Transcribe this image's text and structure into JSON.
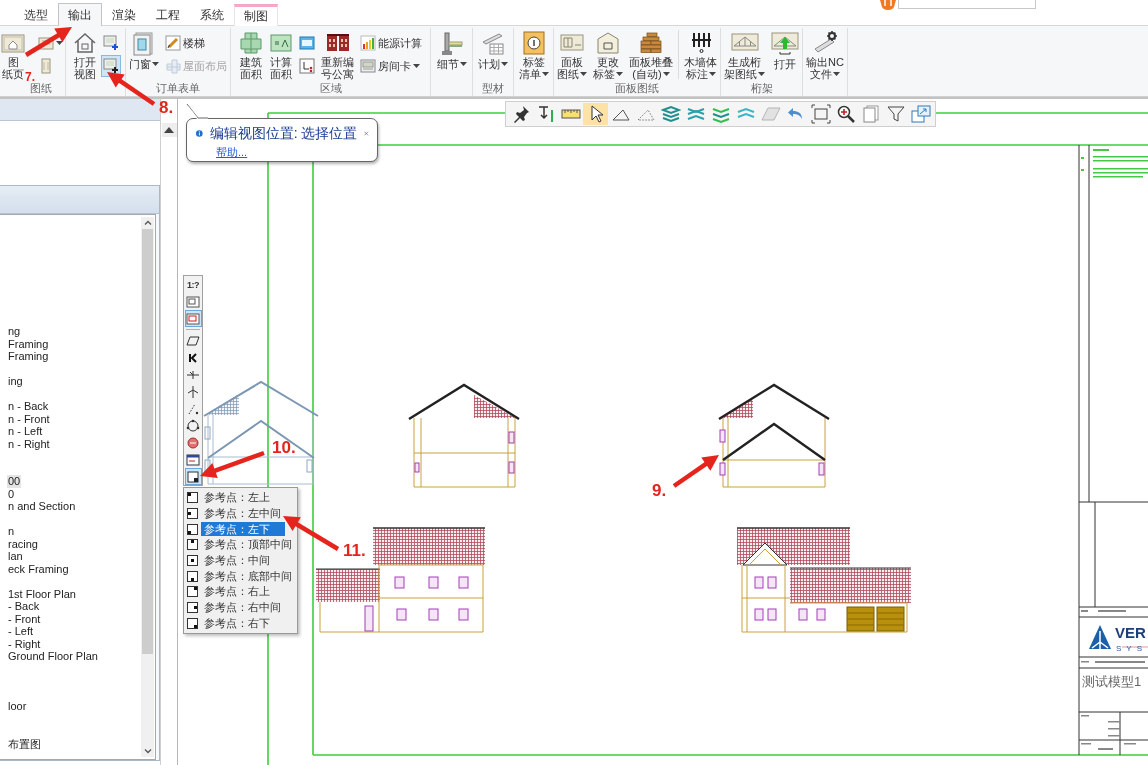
{
  "ribbon_tabs": [
    {
      "label": "选型",
      "kind": "normal",
      "selected": false
    },
    {
      "label": "输出",
      "kind": "normal",
      "selected": true
    },
    {
      "label": "渲染",
      "kind": "normal",
      "selected": false
    },
    {
      "label": "工程",
      "kind": "normal",
      "selected": false
    },
    {
      "label": "系统",
      "kind": "normal",
      "selected": false
    },
    {
      "label": "制图",
      "kind": "contextual",
      "selected": false
    }
  ],
  "ribbon_groups": [
    {
      "label": "图纸",
      "columns": [
        {
          "kind": "large",
          "lines": [
            "图",
            "纸页"
          ],
          "dropdown": false
        },
        {
          "kind": "stack",
          "buttons": [
            {
              "dropdown": true,
              "pressed": false,
              "disabled": false
            },
            {
              "dropdown": false,
              "pressed": false,
              "disabled": false
            }
          ]
        }
      ]
    },
    {
      "columns": [
        {
          "kind": "large",
          "lines": [
            "打开",
            "视图"
          ],
          "dropdown": false
        },
        {
          "kind": "stack",
          "buttons": [
            {
              "dropdown": false,
              "pressed": false,
              "disabled": false
            },
            {
              "dropdown": false,
              "pressed": true,
              "disabled": false
            }
          ]
        }
      ]
    },
    {
      "label": "订单表单",
      "columns": [
        {
          "kind": "large",
          "lines": [
            "门窗"
          ],
          "dropdown": true
        },
        {
          "kind": "stack",
          "buttons": [
            {
              "label": "楼梯",
              "dropdown": false,
              "pressed": false,
              "disabled": false
            },
            {
              "label": "屋面布局",
              "dropdown": false,
              "pressed": false,
              "disabled": true
            }
          ]
        }
      ]
    },
    {
      "label": "区域",
      "columns": [
        {
          "kind": "large",
          "lines": [
            "建筑",
            "面积"
          ],
          "dropdown": false
        },
        {
          "kind": "large",
          "lines": [
            "计算",
            "面积"
          ],
          "dropdown": false
        },
        {
          "kind": "stack",
          "buttons": [
            {
              "dropdown": false,
              "pressed": false,
              "disabled": false
            },
            {
              "dropdown": false,
              "pressed": false,
              "disabled": false
            }
          ]
        },
        {
          "kind": "large",
          "lines": [
            "重新编",
            "号公寓"
          ],
          "dropdown": false
        },
        {
          "kind": "stack",
          "buttons": [
            {
              "label": "能源计算",
              "dropdown": false,
              "pressed": false,
              "disabled": false
            },
            {
              "label": "房间卡",
              "dropdown": true,
              "pressed": false,
              "disabled": false
            }
          ]
        }
      ]
    },
    {
      "columns": [
        {
          "kind": "large",
          "lines": [
            "细节"
          ],
          "dropdown": true
        }
      ]
    },
    {
      "label": "型材",
      "columns": [
        {
          "kind": "large",
          "lines": [
            "计划"
          ],
          "dropdown": true
        }
      ]
    },
    {
      "columns": [
        {
          "kind": "large",
          "lines": [
            "标签",
            "清单"
          ],
          "dropdown": true
        }
      ]
    },
    {
      "label": "面板图纸",
      "columns": [
        {
          "kind": "large",
          "lines": [
            "面板",
            "图纸"
          ],
          "dropdown": true
        },
        {
          "kind": "large",
          "lines": [
            "更改",
            "标签"
          ],
          "dropdown": true
        },
        {
          "kind": "large",
          "lines": [
            "面板堆叠",
            "(自动)"
          ],
          "dropdown": true
        },
        {
          "kind": "separator"
        },
        {
          "kind": "large",
          "lines": [
            "木墙体",
            "标注"
          ],
          "dropdown": true
        }
      ]
    },
    {
      "label": "桁架",
      "columns": [
        {
          "kind": "large",
          "lines": [
            "生成桁",
            "架图纸"
          ],
          "dropdown": true
        },
        {
          "kind": "large",
          "lines": [
            "打开"
          ],
          "dropdown": false
        }
      ]
    },
    {
      "columns": [
        {
          "kind": "large",
          "lines": [
            "输出NC",
            "文件"
          ],
          "dropdown": true
        }
      ]
    }
  ],
  "side_panel": {
    "tree": [
      {
        "items": [
          {
            "label": "ng",
            "selected": false
          },
          {
            "label": "Framing",
            "selected": false
          },
          {
            "label": "Framing",
            "selected": false
          }
        ]
      },
      {
        "items": [
          {
            "label": "ing",
            "selected": false
          }
        ]
      },
      {
        "items": [
          {
            "label": "n - Back",
            "selected": false
          },
          {
            "label": "n - Front",
            "selected": false
          },
          {
            "label": "n - Left",
            "selected": false
          },
          {
            "label": "n - Right",
            "selected": false
          }
        ]
      },
      {
        "items": [
          {
            "label": "00",
            "selected": true
          },
          {
            "label": "0",
            "selected": false
          },
          {
            "label": "n and Section",
            "selected": false
          }
        ]
      },
      {
        "items": [
          {
            "label": "n",
            "selected": false
          },
          {
            "label": "racing",
            "selected": false
          },
          {
            "label": "lan",
            "selected": false
          },
          {
            "label": "eck Framing",
            "selected": false
          }
        ]
      },
      {
        "items": [
          {
            "label": "1st Floor Plan",
            "selected": false
          },
          {
            "label": "- Back",
            "selected": false
          },
          {
            "label": "- Front",
            "selected": false
          },
          {
            "label": "- Left",
            "selected": false
          },
          {
            "label": "- Right",
            "selected": false
          },
          {
            "label": "Ground Floor Plan",
            "selected": false
          }
        ]
      },
      {
        "items": [
          {
            "label": "loor",
            "selected": false
          }
        ]
      },
      {
        "items": [
          {
            "label": "布置图",
            "selected": false
          }
        ]
      }
    ]
  },
  "view_toolbar": [
    {
      "kind": "text",
      "label": "1:?",
      "pressed": false
    },
    {
      "kind": "icon",
      "pressed": false
    },
    {
      "kind": "icon",
      "pressed": true
    },
    {
      "kind": "separator"
    },
    {
      "kind": "icon",
      "pressed": false
    },
    {
      "kind": "icon",
      "pressed": false
    },
    {
      "kind": "icon",
      "pressed": false
    },
    {
      "kind": "icon",
      "pressed": false
    },
    {
      "kind": "icon",
      "pressed": false
    },
    {
      "kind": "icon",
      "pressed": false
    },
    {
      "kind": "icon",
      "pressed": false
    },
    {
      "kind": "icon",
      "pressed": false
    },
    {
      "kind": "icon",
      "pressed": true
    }
  ],
  "reference_menu": [
    {
      "label": "参考点：左上",
      "selected": false
    },
    {
      "label": "参考点：左中间",
      "selected": false
    },
    {
      "label": "参考点：左下",
      "selected": true
    },
    {
      "label": "参考点：顶部中间",
      "selected": false
    },
    {
      "label": "参考点：中间",
      "selected": false
    },
    {
      "label": "参考点：底部中间",
      "selected": false
    },
    {
      "label": "参考点：右上",
      "selected": false
    },
    {
      "label": "参考点：右中间",
      "selected": false
    },
    {
      "label": "参考点：右下",
      "selected": false
    }
  ],
  "tooltip": {
    "message": "编辑视图位置: 选择位置",
    "link": "帮助..."
  },
  "canvas_toolbar": [
    {
      "selected": false
    },
    {
      "selected": false
    },
    {
      "selected": false
    },
    {
      "selected": true
    },
    {
      "selected": false
    },
    {
      "selected": false
    },
    {
      "selected": false
    },
    {
      "selected": false
    },
    {
      "selected": false
    },
    {
      "selected": false
    },
    {
      "selected": false
    },
    {
      "selected": false
    },
    {
      "selected": false
    },
    {
      "selected": false
    },
    {
      "selected": false
    },
    {
      "selected": false
    },
    {
      "selected": false
    }
  ],
  "title_block": {
    "logo_lines": [
      "VER",
      "SYS"
    ],
    "project": "测试模型1"
  },
  "annotations": [
    {
      "label": "7."
    },
    {
      "label": "8."
    },
    {
      "label": "9."
    },
    {
      "label": "10."
    },
    {
      "label": "11."
    }
  ]
}
